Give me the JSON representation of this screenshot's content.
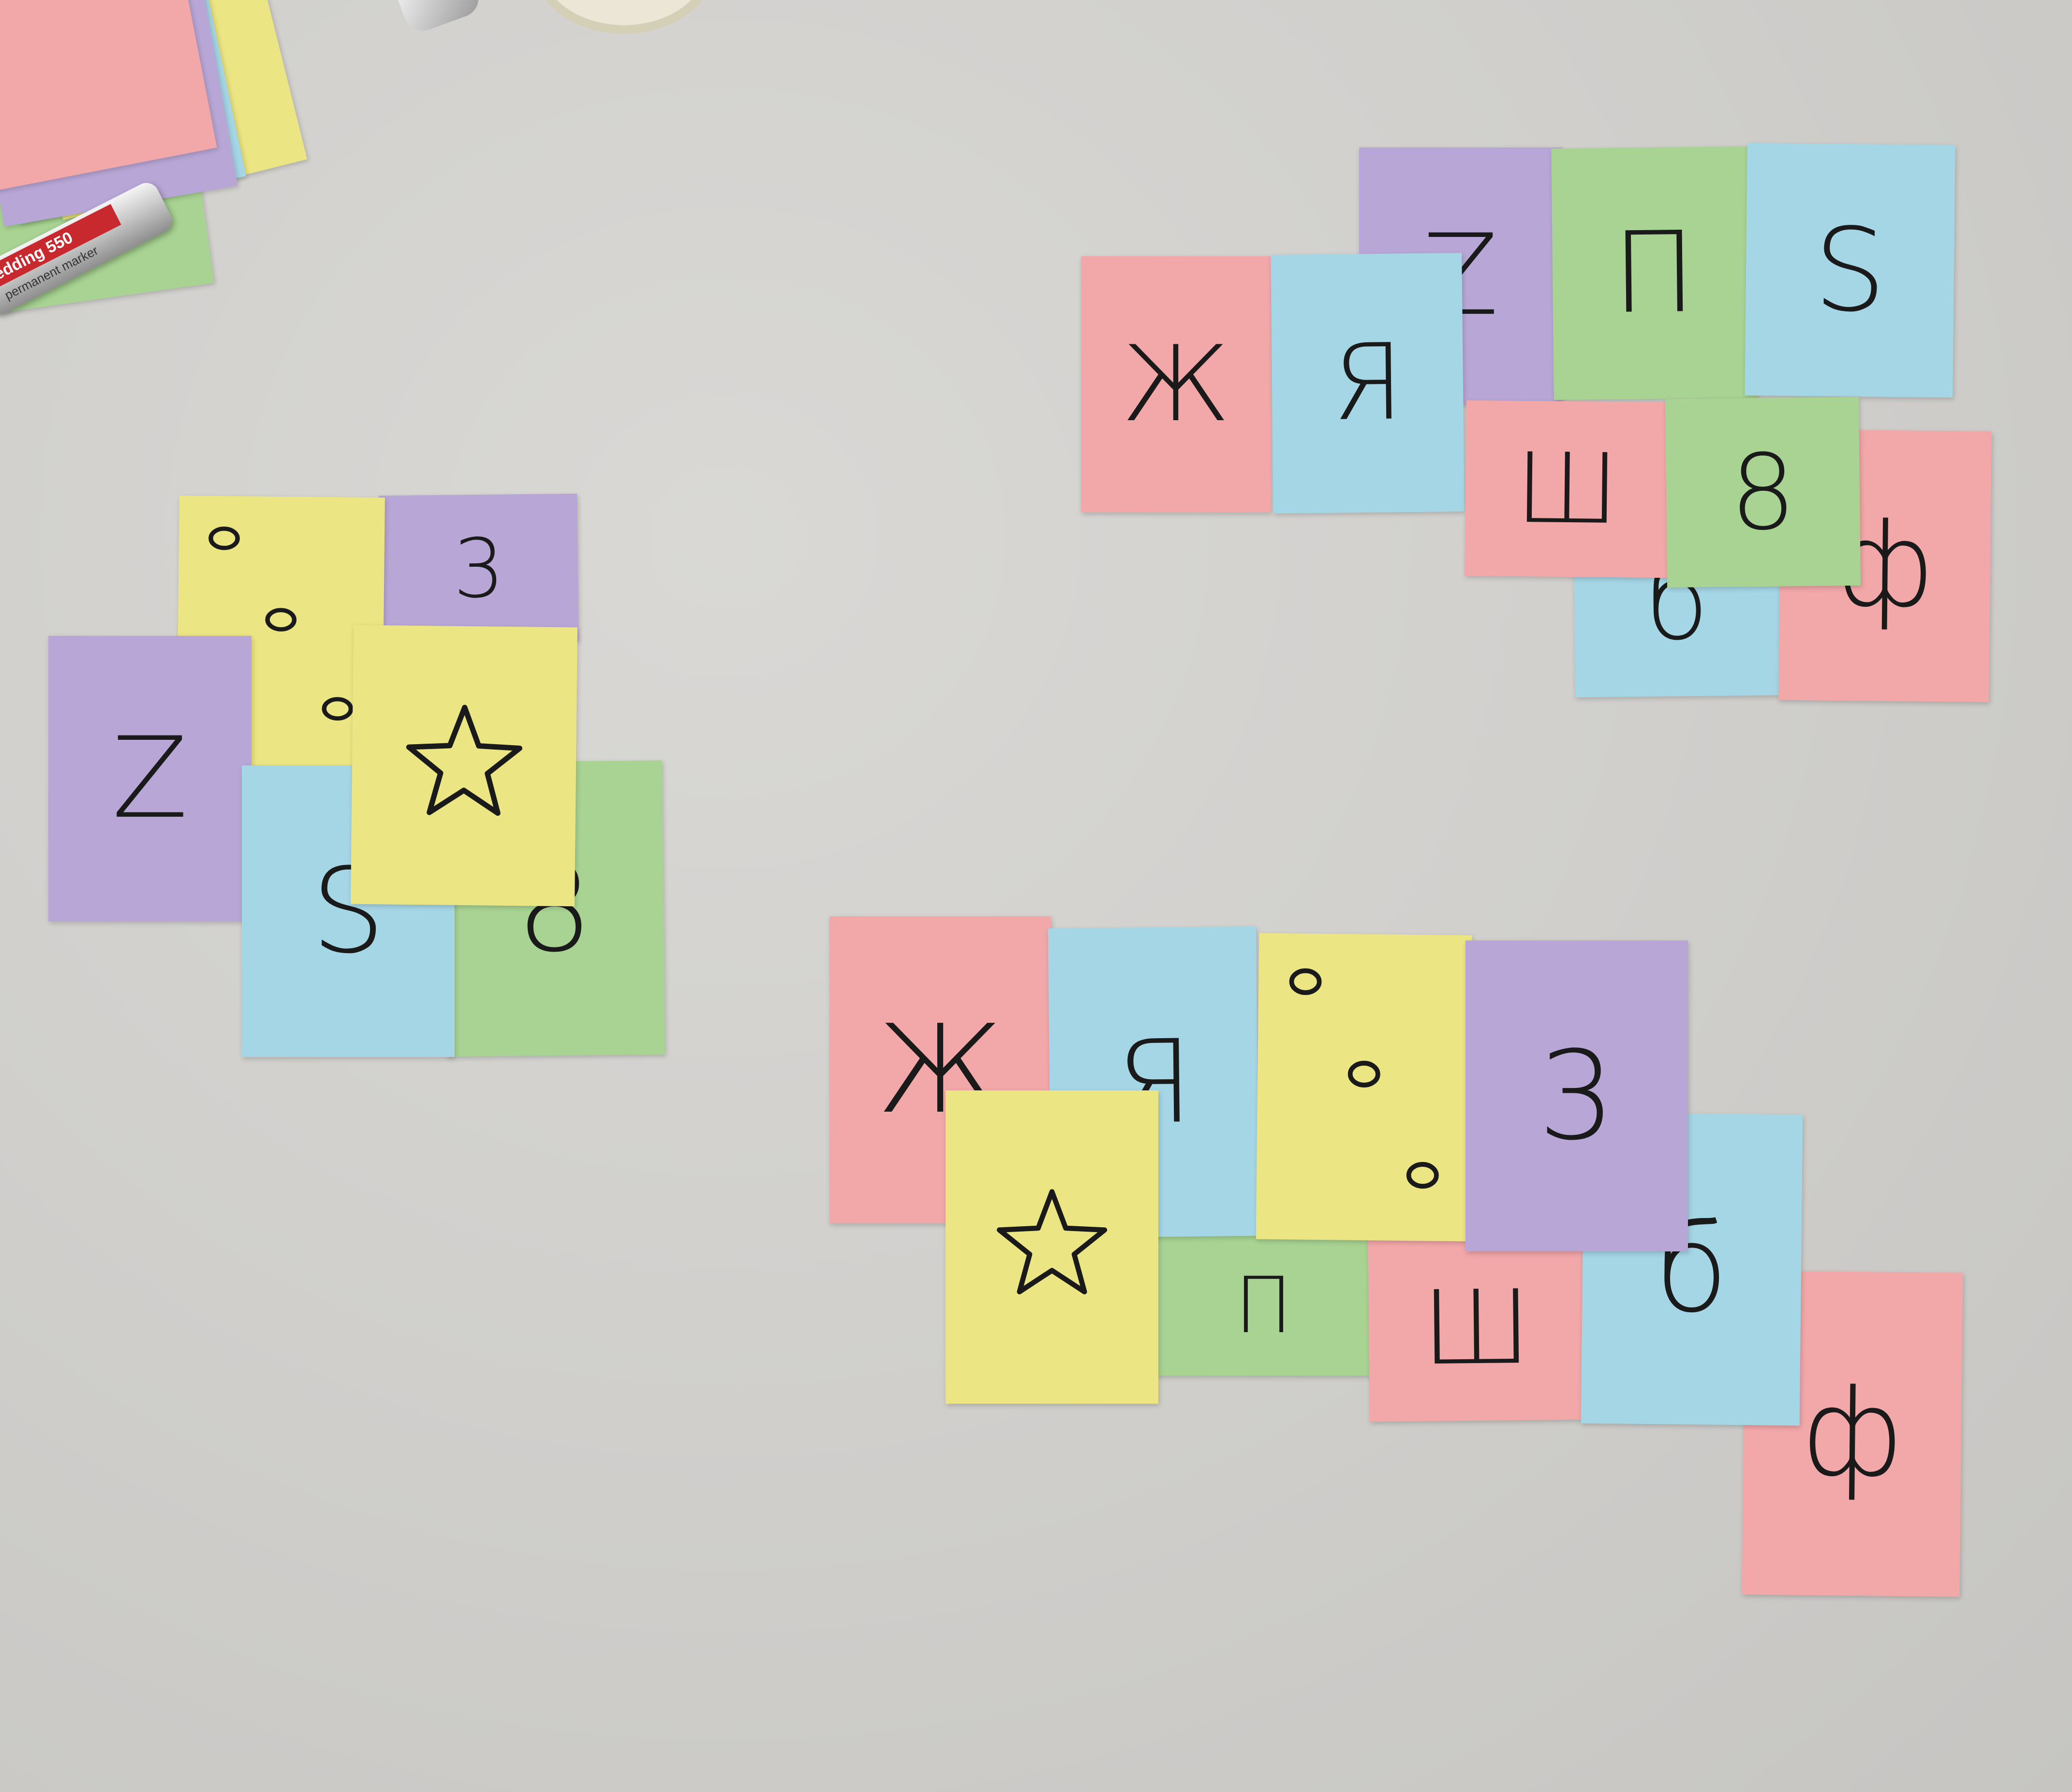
{
  "scene": {
    "surface_color": "#d3d2cf",
    "card_colors": {
      "pink": "#f2a7a8",
      "blue": "#a5d6e6",
      "purple": "#b8a6d6",
      "green": "#a8d392",
      "yellow": "#ece584"
    },
    "marker": {
      "brand": "edding 550",
      "subtitle": "permanent marker"
    },
    "groups": [
      {
        "name": "left-cluster",
        "cards": [
          {
            "color": "purple",
            "symbol": "3"
          },
          {
            "color": "yellow",
            "symbol": "dots"
          },
          {
            "color": "purple",
            "symbol": "Z"
          },
          {
            "color": "green",
            "symbol": "8"
          },
          {
            "color": "blue",
            "symbol": "S"
          },
          {
            "color": "yellow",
            "symbol": "star"
          }
        ]
      },
      {
        "name": "top-right-cluster",
        "cards": [
          {
            "color": "blue",
            "symbol": "б"
          },
          {
            "color": "pink",
            "symbol": "ф"
          },
          {
            "color": "purple",
            "symbol": "Z"
          },
          {
            "color": "green",
            "symbol": "П"
          },
          {
            "color": "blue",
            "symbol": "S"
          },
          {
            "color": "pink",
            "symbol": "Ж"
          },
          {
            "color": "blue",
            "symbol": "Я"
          },
          {
            "color": "pink",
            "symbol": "Ш"
          },
          {
            "color": "green",
            "symbol": "8"
          }
        ]
      },
      {
        "name": "bottom-cluster",
        "cards": [
          {
            "color": "pink",
            "symbol": "ф"
          },
          {
            "color": "green",
            "symbol": "П"
          },
          {
            "color": "pink",
            "symbol": "Ш"
          },
          {
            "color": "blue",
            "symbol": "б"
          },
          {
            "color": "pink",
            "symbol": "Ж"
          },
          {
            "color": "blue",
            "symbol": "Я"
          },
          {
            "color": "yellow",
            "symbol": "dots"
          },
          {
            "color": "purple",
            "symbol": "3"
          },
          {
            "color": "yellow",
            "symbol": "star"
          }
        ]
      }
    ]
  }
}
